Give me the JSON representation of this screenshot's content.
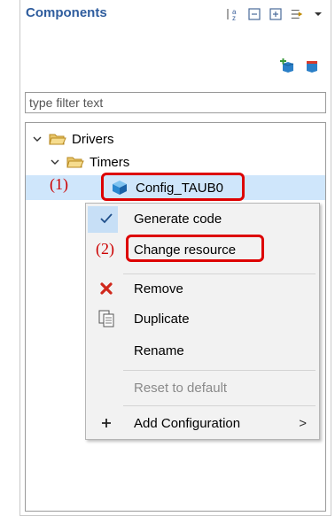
{
  "panel": {
    "title": "Components"
  },
  "filter": {
    "placeholder": "type filter text"
  },
  "tree": {
    "drivers_label": "Drivers",
    "timers_label": "Timers",
    "config_label": "Config_TAUB0"
  },
  "annotations": {
    "one": "(1)",
    "two": "(2)"
  },
  "menu": {
    "generate_code": "Generate code",
    "change_resource": "Change resource",
    "remove": "Remove",
    "duplicate": "Duplicate",
    "rename": "Rename",
    "reset_to_default": "Reset to default",
    "add_configuration": "Add Configuration",
    "submenu_arrow": ">"
  },
  "colors": {
    "title": "#2f5d9e",
    "selection": "#cfe6fb",
    "annotation_red": "#cc0000"
  },
  "icons": {
    "sort": "sort-az-icon",
    "collapse": "collapse-all-icon",
    "expand": "expand-all-icon",
    "filter": "filter-icon",
    "view_menu": "view-menu-icon",
    "add_component": "add-component-icon",
    "remove_component": "remove-component-icon"
  }
}
